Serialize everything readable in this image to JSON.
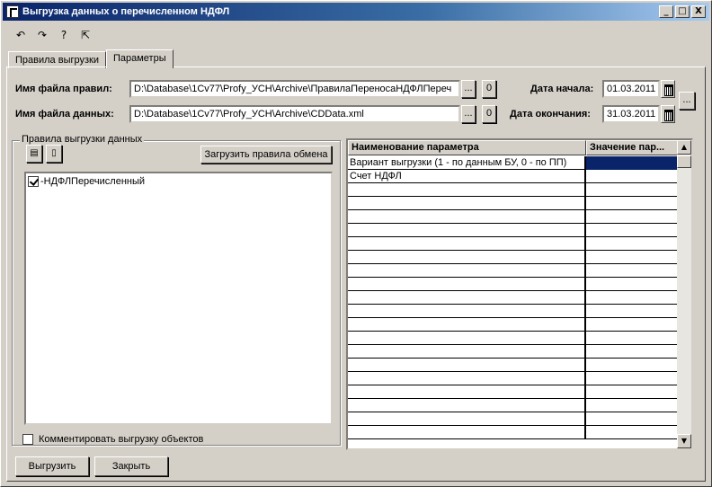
{
  "window": {
    "title": "Выгрузка данных о перечисленном НДФЛ",
    "minimize": "_",
    "maximize": "□",
    "close": "X"
  },
  "toolbar": {
    "icons": [
      "undo-arrow-icon",
      "redo-arrow-icon",
      "help-question-icon",
      "pointer-help-icon"
    ],
    "glyphs": [
      "↶",
      "↷",
      "?",
      "⇱"
    ]
  },
  "tabs": [
    {
      "label": "Правила выгрузки",
      "active": false
    },
    {
      "label": "Параметры",
      "active": true
    }
  ],
  "form": {
    "rules_file_label": "Имя файла правил:",
    "rules_file_value": "D:\\Database\\1Cv77\\Profy_УСН\\Archive\\ПравилаПереносаНДФЛПереч",
    "data_file_label": "Имя файла данных:",
    "data_file_value": "D:\\Database\\1Cv77\\Profy_УСН\\Archive\\CDData.xml",
    "browse_label": "...",
    "open_label": "0",
    "start_date_label": "Дата начала:",
    "start_date_value": "01.03.2011",
    "end_date_label": "Дата окончания:",
    "end_date_value": "31.03.2011",
    "period_button_label": "..."
  },
  "rules_group": {
    "title": "Правила выгрузки данных",
    "load_button": "Загрузить правила обмена",
    "tree_items": [
      {
        "label": "-НДФЛПеречисленный",
        "checked": true
      }
    ],
    "comment_checkbox_label": "Комментировать выгрузку объектов",
    "comment_checked": false
  },
  "params_grid": {
    "columns": [
      "Наименование параметра",
      "Значение пар..."
    ],
    "rows": [
      {
        "name": "Вариант выгрузки (1 - по данным БУ, 0 - по ПП)",
        "value": "",
        "selected": true
      },
      {
        "name": "Счет НДФЛ",
        "value": "",
        "selected": false
      }
    ]
  },
  "buttons": {
    "export": "Выгрузить",
    "close": "Закрыть"
  }
}
